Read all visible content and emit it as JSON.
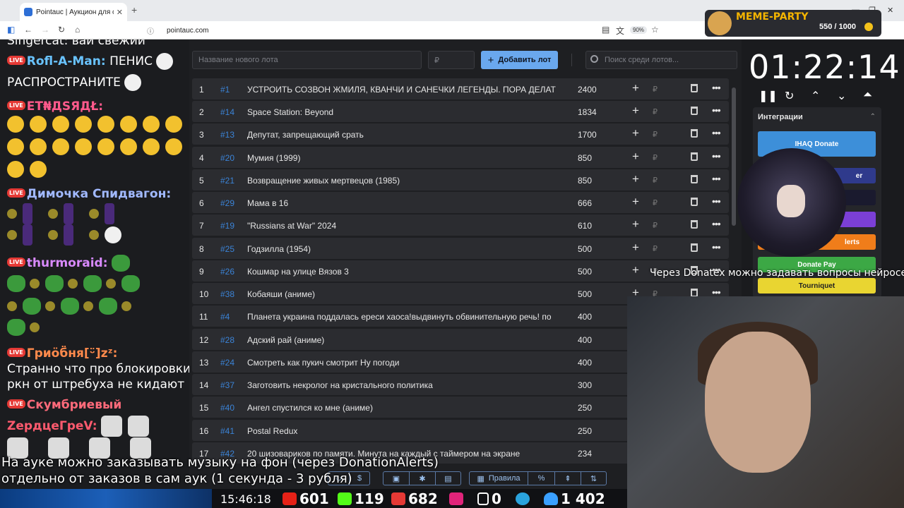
{
  "browser": {
    "tab_title": "Pointauc | Аукцион для стриме",
    "url": "pointauc.com",
    "zoom": "90%"
  },
  "chat": {
    "lines": [
      {
        "text": "Singercat: вай свежий"
      },
      {
        "name": "Rofl-A-Man:",
        "message": "ПЕНИС"
      },
      {
        "text": "РАСПРОСТРАНИТЕ"
      },
      {
        "name": "ЕТ₦ДЅЯДŁ:"
      },
      {
        "name": "Димочка Спидвагон:"
      },
      {
        "name": "thurmoraid:"
      },
      {
        "name": "Гриӧб̈̈ня[ᵕ̈]zᶻ:"
      },
      {
        "text": "Странно что про блокировки"
      },
      {
        "text": "ркн от штребуха не кидают"
      },
      {
        "name": "Скумбриевый"
      },
      {
        "name": "ZердцеГреV:"
      }
    ]
  },
  "app": {
    "new_lot_placeholder": "Название нового лота",
    "sum_placeholder": "₽",
    "add_button": "Добавить лот",
    "search_placeholder": "Поиск среди лотов...",
    "lots": [
      {
        "index": "1",
        "id": "#1",
        "name": "УСТРОИТЬ СОЗВОН ЖМИЛЯ, КВАНЧИ И САНЕЧКИ ЛЕГЕНДЫ. ПОРА ДЕЛАТ",
        "amount": "2400"
      },
      {
        "index": "2",
        "id": "#14",
        "name": "Space Station: Beyond",
        "amount": "1834"
      },
      {
        "index": "3",
        "id": "#13",
        "name": "Депутат, запрещающий срать",
        "amount": "1700"
      },
      {
        "index": "4",
        "id": "#20",
        "name": "Мумия (1999)",
        "amount": "850"
      },
      {
        "index": "5",
        "id": "#21",
        "name": "Возвращение живых мертвецов (1985)",
        "amount": "850"
      },
      {
        "index": "6",
        "id": "#29",
        "name": "Мама в 16",
        "amount": "666"
      },
      {
        "index": "7",
        "id": "#19",
        "name": "\"Russians at War\" 2024",
        "amount": "610"
      },
      {
        "index": "8",
        "id": "#25",
        "name": "Годзилла (1954)",
        "amount": "500"
      },
      {
        "index": "9",
        "id": "#26",
        "name": "Кошмар на улице Вязов 3",
        "amount": "500"
      },
      {
        "index": "10",
        "id": "#38",
        "name": "Кобаяши (аниме)",
        "amount": "500"
      },
      {
        "index": "11",
        "id": "#4",
        "name": "Планета украина поддалась ереси хаоса!выдвинуть обвинительную речь! по",
        "amount": "400"
      },
      {
        "index": "12",
        "id": "#28",
        "name": "Адский рай (аниме)",
        "amount": "400"
      },
      {
        "index": "13",
        "id": "#24",
        "name": "Смотреть как пукич смотрит Ну погоди",
        "amount": "400"
      },
      {
        "index": "14",
        "id": "#37",
        "name": "Заготовить некролог на кристального политика",
        "amount": "300"
      },
      {
        "index": "15",
        "id": "#40",
        "name": "Ангел спустился ко мне (аниме)",
        "amount": "250"
      },
      {
        "index": "16",
        "id": "#41",
        "name": "Postal Redux",
        "amount": "250"
      },
      {
        "index": "17",
        "id": "#42",
        "name": "20 шизовариков по памяти. Минута на каждый с таймером на экране",
        "amount": "234"
      }
    ],
    "toolbar": {
      "dollar": "$",
      "rules": "Правила",
      "percent": "%"
    }
  },
  "right": {
    "meme_party_title": "MEME-PARTY",
    "meme_counter": "550 / 1000",
    "timer": "01:22:14",
    "integrations_title": "Интеграции",
    "integrations": [
      {
        "label": "IHAQ Donate",
        "color": "#3d8fd9"
      },
      {
        "label": "er",
        "color": "#2f3a8c"
      },
      {
        "label": "",
        "color": "#1a1a2e"
      },
      {
        "label": "",
        "color": "#7b3fd6"
      },
      {
        "label": "lerts",
        "color": "#f07d1a"
      },
      {
        "label": "Donate Pay",
        "color": "#3ca845"
      },
      {
        "label": "Tourniquet",
        "color": "#e9d531"
      }
    ]
  },
  "overlays": {
    "question_note": "Через Donatex можно задавать вопросы нейросети",
    "music_note_line1": "На ауке можно заказывать музыку на фон (через DonationAlerts)",
    "music_note_line2": "отдельно от заказов в сам аук (1 секунда - 3 рубля)"
  },
  "status": {
    "time": "15:46:18",
    "youtube_viewers": "601",
    "kick_viewers": "119",
    "vk_live_viewers": "682",
    "rutube_viewers": "0",
    "telegram_viewers": "",
    "total_viewers": "1 402"
  },
  "colors": {
    "accent_blue": "#6aa8ee",
    "id_blue": "#3b83d6",
    "row_bg": "#2b2c30"
  }
}
